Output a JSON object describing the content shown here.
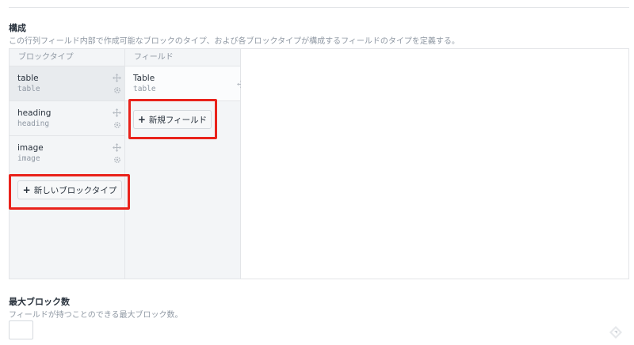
{
  "structure": {
    "title": "構成",
    "description": "この行列フィールド内部で作成可能なブロックのタイプ、および各ブロックタイプが構成するフィールドのタイプを定義する。",
    "block_types": {
      "header": "ブロックタイプ",
      "items": [
        {
          "name": "table",
          "handle": "table",
          "selected": true
        },
        {
          "name": "heading",
          "handle": "heading",
          "selected": false
        },
        {
          "name": "image",
          "handle": "image",
          "selected": false
        }
      ],
      "new_button": "新しいブロックタイプ"
    },
    "fields": {
      "header": "フィールド",
      "items": [
        {
          "name": "Table",
          "handle": "table"
        }
      ],
      "new_button": "新規フィールド"
    }
  },
  "max_blocks": {
    "title": "最大ブロック数",
    "description": "フィールドが持つことのできる最大ブロック数。",
    "value": ""
  },
  "colors": {
    "highlight": "#e9221b",
    "column_bg": "#f3f5f7",
    "border": "#e3e5e8",
    "muted_text": "#8f98a3"
  },
  "icons": {
    "move": "move-icon",
    "settings": "gear-icon",
    "plus": "plus-icon"
  }
}
